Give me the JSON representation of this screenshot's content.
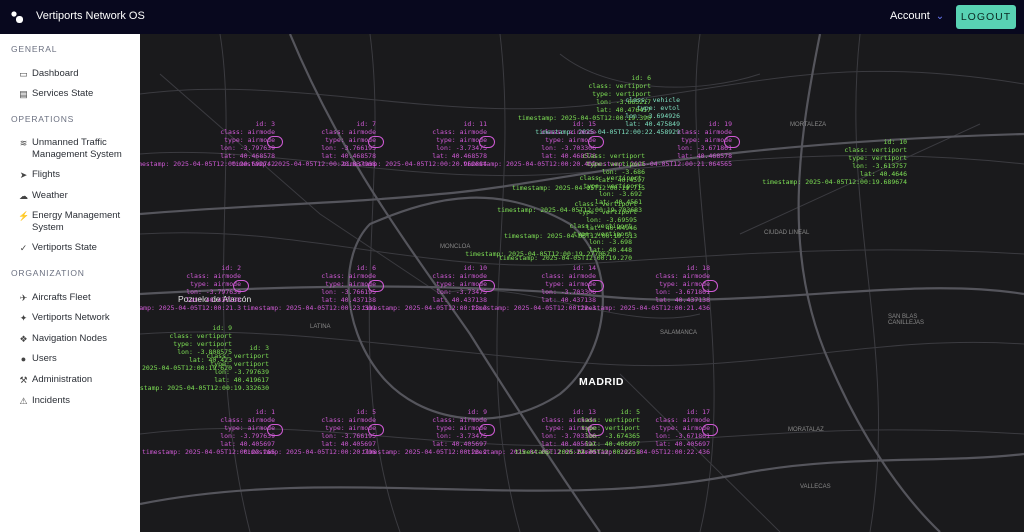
{
  "header": {
    "title": "Vertiports Network OS",
    "account_label": "Account",
    "logout_label": "LOGOUT"
  },
  "sidebar": {
    "sections": [
      {
        "title": "GENERAL",
        "items": [
          {
            "label": "Dashboard",
            "icon": "monitor-icon"
          },
          {
            "label": "Services State",
            "icon": "server-icon"
          }
        ]
      },
      {
        "title": "OPERATIONS",
        "items": [
          {
            "label": "Unmanned Traffic Management System",
            "icon": "signal-icon"
          },
          {
            "label": "Flights",
            "icon": "send-icon"
          },
          {
            "label": "Weather",
            "icon": "cloud-icon"
          },
          {
            "label": "Energy Management System",
            "icon": "bolt-icon"
          },
          {
            "label": "Vertiports State",
            "icon": "check-icon"
          }
        ]
      },
      {
        "title": "ORGANIZATION",
        "items": [
          {
            "label": "Aircrafts Fleet",
            "icon": "plane-icon"
          },
          {
            "label": "Vertiports Network",
            "icon": "pin-icon"
          },
          {
            "label": "Navigation Nodes",
            "icon": "compass-icon"
          },
          {
            "label": "Users",
            "icon": "users-icon"
          },
          {
            "label": "Administration",
            "icon": "wrench-icon"
          },
          {
            "label": "Incidents",
            "icon": "bell-icon"
          }
        ]
      }
    ]
  },
  "map": {
    "city_label": "MADRID",
    "place_labels": [
      "Pozuelo de Alarcón",
      "MORTALEZA",
      "CIUDAD LINEAL",
      "SAN BLAS CANILLEJAS",
      "MORATALAZ",
      "SALAMANCA",
      "VALLECAS",
      "MONCLOA",
      "LATINA"
    ],
    "overlays": [
      {
        "kind": "air",
        "lines": [
          "id: 3",
          "class: airmode",
          "type: airmode",
          "lon: -3.797639",
          "lat: 40.468578",
          "timestamp: 2025-04-05T12:00:20.692742"
        ]
      },
      {
        "kind": "air",
        "lines": [
          "id: 7",
          "class: airmode",
          "type: airmode",
          "lon: -3.766195",
          "lat: 40.468578",
          "timestamp: 2025-04-05T12:00:20.837068"
        ]
      },
      {
        "kind": "air",
        "lines": [
          "id: 11",
          "class: airmode",
          "type: airmode",
          "lon: -3.73475",
          "lat: 40.468578",
          "timestamp: 2025-04-05T12:00:20.962884"
        ]
      },
      {
        "kind": "vp",
        "lines": [
          "id: 6",
          "class: vertiport",
          "type: vertiport",
          "lon: -3.665217",
          "lat: 40.476457",
          "timestamp: 2025-04-05T12:00:19.390"
        ]
      },
      {
        "kind": "veh",
        "lines": [
          "class: vehicle",
          "type: evtol",
          "lon: -3.694926",
          "lat: 40.475849",
          "timestamp: 2025-04-05T12:00:22.458929"
        ]
      },
      {
        "kind": "air",
        "lines": [
          "id: 15",
          "class: airmode",
          "type: airmode",
          "lon: -3.703306",
          "lat: 40.468578",
          "timestamp: 2025-04-05T12:00:20.409"
        ]
      },
      {
        "kind": "air",
        "lines": [
          "id: 19",
          "class: airmode",
          "type: airmode",
          "lon: -3.671861",
          "lat: 40.468578",
          "timestamp: 2025-04-05T12:00:21.064565"
        ]
      },
      {
        "kind": "vp",
        "lines": [
          "id: 10",
          "class: vertiport",
          "type: vertiport",
          "lon: -3.613757",
          "lat: 40.4646",
          "timestamp: 2025-04-05T12:00:19.689674"
        ]
      },
      {
        "kind": "vp",
        "lines": [
          "class: vertiport",
          "type: vertiport",
          "lon: -3.686",
          "lat: 40.4597",
          "timestamp: 2025-04-05T12:00:19.715"
        ]
      },
      {
        "kind": "vp",
        "lines": [
          "class: vertiport",
          "type: vertiport",
          "lon: -3.692",
          "lat: 40.4561",
          "timestamp: 2025-04-05T12:00:19.703683"
        ]
      },
      {
        "kind": "vp",
        "lines": [
          "class: vertiport",
          "type: vertiport",
          "lon: -3.69595",
          "lat: 40.44946",
          "timestamp: 2025-04-05T12:00:19.313"
        ]
      },
      {
        "kind": "vp",
        "lines": [
          "class: vertiport",
          "type: vertiport",
          "lon: -3.698",
          "lat: 40.448",
          "timestamp: 2025-04-05T12:00:19.270"
        ]
      },
      {
        "kind": "vp",
        "lines": [
          "timestamp: 2025-04-05T12:00:19.277062"
        ]
      },
      {
        "kind": "air",
        "lines": [
          "id: 2",
          "class: airmode",
          "type: airmode",
          "lon: -3.797639",
          "lat: 40.437138",
          "timestamp: 2025-04-05T12:00:21.3"
        ]
      },
      {
        "kind": "air",
        "lines": [
          "id: 6",
          "class: airmode",
          "type: airmode",
          "lon: -3.766195",
          "lat: 40.437138",
          "timestamp: 2025-04-05T12:00:23.301"
        ]
      },
      {
        "kind": "air",
        "lines": [
          "id: 10",
          "class: airmode",
          "type: airmode",
          "lon: -3.73475",
          "lat: 40.437138",
          "timestamp: 2025-04-05T12:00:23.3"
        ]
      },
      {
        "kind": "air",
        "lines": [
          "id: 14",
          "class: airmode",
          "type: airmode",
          "lon: -3.703306",
          "lat: 40.437138",
          "timestamp: 2025-04-05T12:00:22.3"
        ]
      },
      {
        "kind": "air",
        "lines": [
          "id: 18",
          "class: airmode",
          "type: airmode",
          "lon: -3.671861",
          "lat: 40.437138",
          "timestamp: 2025-04-05T12:00:21.436"
        ]
      },
      {
        "kind": "vp",
        "lines": [
          "id: 9",
          "class: vertiport",
          "type: vertiport",
          "lon: -3.808575",
          "lat: 40.423",
          "timestamp: 2025-04-05T12:00:19.620"
        ]
      },
      {
        "kind": "vp",
        "lines": [
          "id: 3",
          "class: vertiport",
          "type: vertiport",
          "lon: -3.797639",
          "lat: 40.419617",
          "timestamp: 2025-04-05T12:00:19.332630"
        ]
      },
      {
        "kind": "air",
        "lines": [
          "id: 1",
          "class: airmode",
          "type: airmode",
          "lon: -3.797639",
          "lat: 40.405697",
          "timestamp: 2025-04-05T12:00:23.265"
        ]
      },
      {
        "kind": "air",
        "lines": [
          "id: 5",
          "class: airmode",
          "type: airmode",
          "lon: -3.766195",
          "lat: 40.405697",
          "timestamp: 2025-04-05T12:00:20.706"
        ]
      },
      {
        "kind": "air",
        "lines": [
          "id: 9",
          "class: airmode",
          "type: airmode",
          "lon: -3.73475",
          "lat: 40.405697",
          "timestamp: 2025-04-05T12:00:23.2"
        ]
      },
      {
        "kind": "air",
        "lines": [
          "id: 13",
          "class: airmode",
          "type: airmode",
          "lon: -3.703306",
          "lat: 40.405697",
          "timestamp: 2025-04-05T12:00:22.70"
        ]
      },
      {
        "kind": "vp",
        "lines": [
          "id: 5",
          "class: vertiport",
          "type: vertiport",
          "lon: -3.674365",
          "lat: 40.405697",
          "timestamp: 2025-04-05T12:00:22.8"
        ]
      },
      {
        "kind": "air",
        "lines": [
          "id: 17",
          "class: airmode",
          "type: airmode",
          "lon: -3.671861",
          "lat: 40.405697",
          "timestamp: 2025-04-05T12:00:22.436"
        ]
      }
    ]
  },
  "colors": {
    "accent": "#58d2b4",
    "airmode": "#d05ad6",
    "vertiport": "#7ee055",
    "header_bg": "#08081e"
  }
}
